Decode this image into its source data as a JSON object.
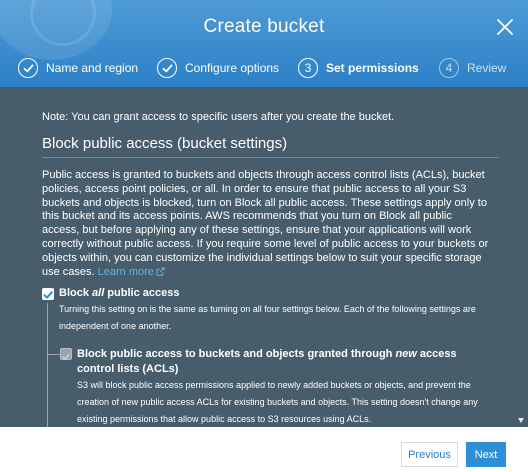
{
  "header": {
    "title": "Create bucket",
    "steps": [
      {
        "label": "Name and region",
        "state": "done",
        "marker": "check"
      },
      {
        "label": "Configure options",
        "state": "done",
        "marker": "check"
      },
      {
        "label": "Set permissions",
        "state": "active",
        "marker": "3"
      },
      {
        "label": "Review",
        "state": "future",
        "marker": "4"
      }
    ]
  },
  "content": {
    "note": "Note: You can grant access to specific users after you create the bucket.",
    "section_title": "Block public access (bucket settings)",
    "description": "Public access is granted to buckets and objects through access control lists (ACLs), bucket policies, access point policies, or all. In order to ensure that public access to all your S3 buckets and objects is blocked, turn on Block all public access. These settings apply only to this bucket and its access points. AWS recommends that you turn on Block all public access, but before applying any of these settings, ensure that your applications will work correctly without public access. If you require some level of public access to your buckets or objects within, you can customize the individual settings below to suit your specific storage use cases.",
    "learn_more": "Learn more",
    "block_all": {
      "label_prefix": "Block ",
      "label_em": "all",
      "label_suffix": " public access",
      "checked": true,
      "description": "Turning this setting on is the same as turning on all four settings below. Each of the following settings are independent of one another."
    },
    "block_acls": {
      "label_prefix": "Block public access to buckets and objects granted through ",
      "label_em": "new",
      "label_suffix": " access control lists (ACLs)",
      "checked": true,
      "disabled": true,
      "description": "S3 will block public access permissions applied to newly added buckets or objects, and prevent the creation of new public access ACLs for existing buckets and objects. This setting doesn't change any existing permissions that allow public access to S3 resources using ACLs."
    }
  },
  "footer": {
    "previous_label": "Previous",
    "next_label": "Next"
  },
  "colors": {
    "header": "#2c80c6",
    "content_bg": "#475d6c",
    "link": "#5fb6ea",
    "primary_button": "#2d8fd5"
  }
}
